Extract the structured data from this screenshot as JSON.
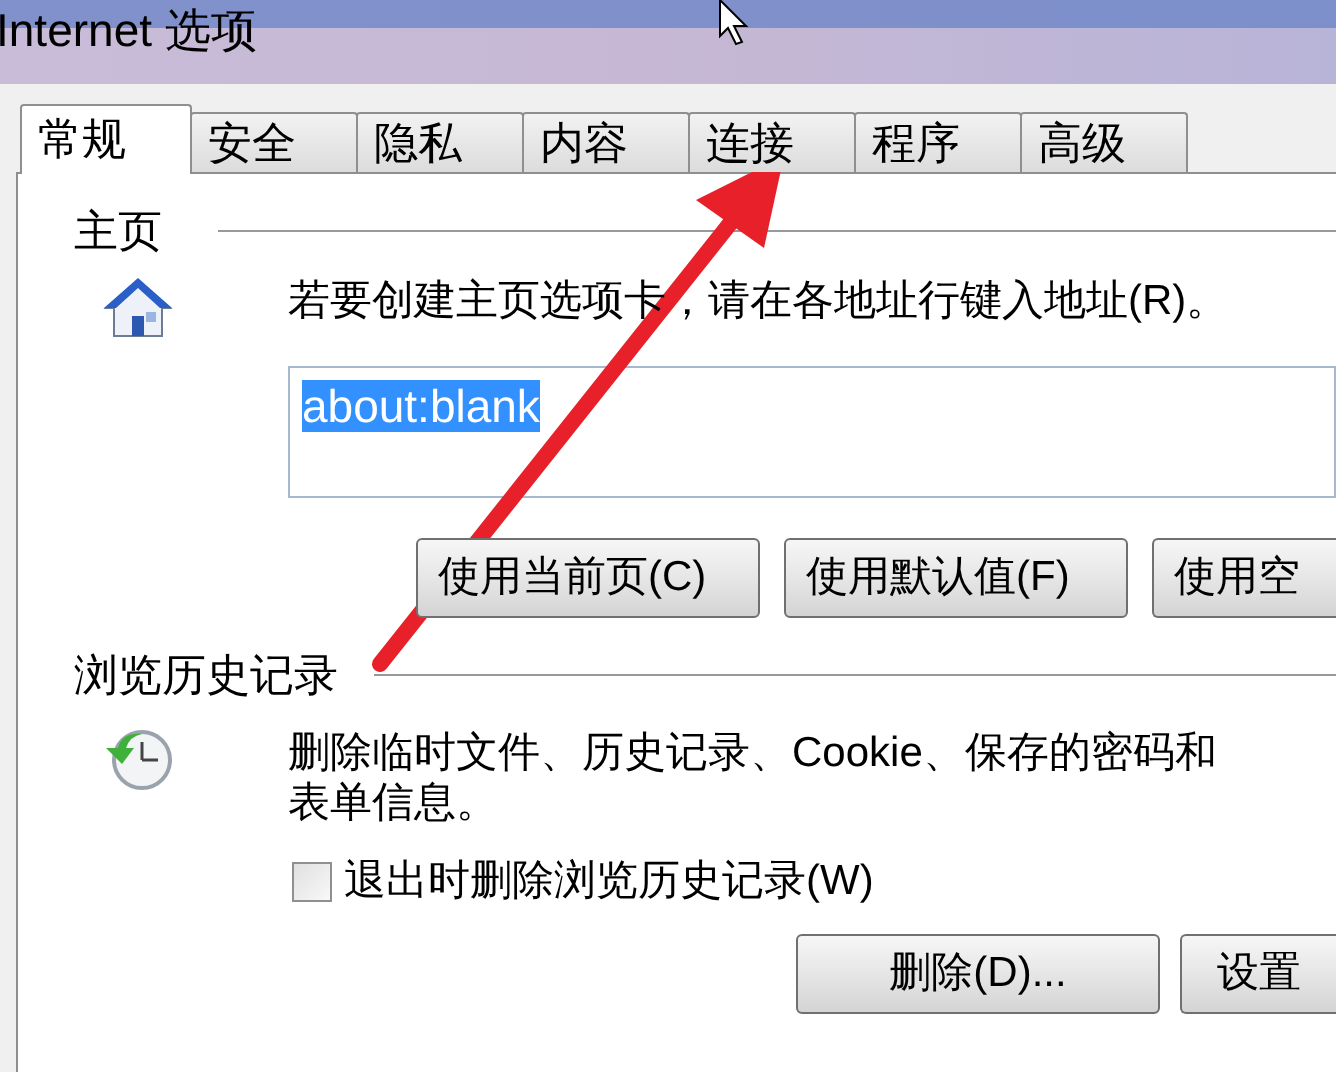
{
  "window": {
    "title": "Internet 选项"
  },
  "tabs": [
    {
      "label": "常规",
      "selected": true
    },
    {
      "label": "安全",
      "selected": false
    },
    {
      "label": "隐私",
      "selected": false
    },
    {
      "label": "内容",
      "selected": false
    },
    {
      "label": "连接",
      "selected": false
    },
    {
      "label": "程序",
      "selected": false
    },
    {
      "label": "高级",
      "selected": false
    }
  ],
  "home_page": {
    "heading": "主页",
    "description": "若要创建主页选项卡，请在各地址行键入地址(R)。",
    "address": "about:blank",
    "address_selected": true,
    "buttons": [
      "使用当前页(C)",
      "使用默认值(F)",
      "使用空"
    ]
  },
  "browsing_history": {
    "heading": "浏览历史记录",
    "description_lines": [
      "删除临时文件、历史记录、Cookie、保存的密码和",
      "表单信息。"
    ],
    "delete_on_exit": {
      "label": "退出时删除浏览历史记录(W)",
      "checked": false
    },
    "buttons": [
      "删除(D)...",
      "设置"
    ]
  }
}
